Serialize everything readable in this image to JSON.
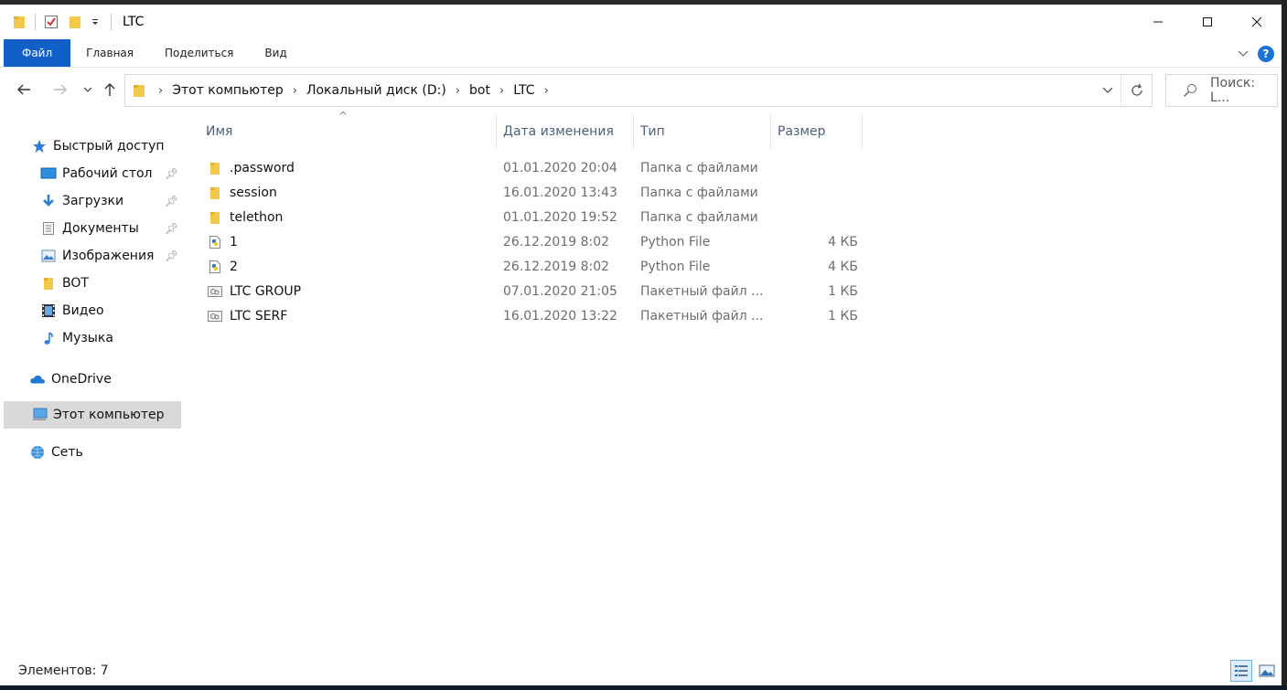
{
  "window": {
    "title": "LTC",
    "controls": {
      "minimize": "—",
      "maximize": "☐",
      "close": "✕"
    }
  },
  "ribbon": {
    "tabs": [
      "Файл",
      "Главная",
      "Поделиться",
      "Вид"
    ],
    "help": "?"
  },
  "nav": {
    "breadcrumb": [
      "Этот компьютер",
      "Локальный диск (D:)",
      "bot",
      "LTC"
    ],
    "search_placeholder": "Поиск: L..."
  },
  "sidebar": {
    "items": [
      {
        "label": "Быстрый доступ",
        "icon": "star-icon"
      },
      {
        "label": "Рабочий стол",
        "icon": "desktop-icon",
        "pinned": true
      },
      {
        "label": "Загрузки",
        "icon": "download-icon",
        "pinned": true
      },
      {
        "label": "Документы",
        "icon": "documents-icon",
        "pinned": true
      },
      {
        "label": "Изображения",
        "icon": "pictures-icon",
        "pinned": true
      },
      {
        "label": "BOT",
        "icon": "folder-icon"
      },
      {
        "label": "Видео",
        "icon": "video-icon"
      },
      {
        "label": "Музыка",
        "icon": "music-icon"
      },
      {
        "label": "OneDrive",
        "icon": "cloud-icon"
      },
      {
        "label": "Этот компьютер",
        "icon": "computer-icon",
        "selected": true
      },
      {
        "label": "Сеть",
        "icon": "network-icon"
      }
    ]
  },
  "columns": {
    "name": "Имя",
    "date": "Дата изменения",
    "type": "Тип",
    "size": "Размер"
  },
  "files": [
    {
      "name": ".password",
      "date": "01.01.2020 20:04",
      "type": "Папка с файлами",
      "size": "",
      "icon": "folder-icon"
    },
    {
      "name": "session",
      "date": "16.01.2020 13:43",
      "type": "Папка с файлами",
      "size": "",
      "icon": "folder-icon"
    },
    {
      "name": "telethon",
      "date": "01.01.2020 19:52",
      "type": "Папка с файлами",
      "size": "",
      "icon": "folder-icon"
    },
    {
      "name": "1",
      "date": "26.12.2019 8:02",
      "type": "Python File",
      "size": "4 КБ",
      "icon": "python-file-icon"
    },
    {
      "name": "2",
      "date": "26.12.2019 8:02",
      "type": "Python File",
      "size": "4 КБ",
      "icon": "python-file-icon"
    },
    {
      "name": "LTC GROUP",
      "date": "07.01.2020 21:05",
      "type": "Пакетный файл ...",
      "size": "1 КБ",
      "icon": "batch-file-icon"
    },
    {
      "name": "LTC SERF",
      "date": "16.01.2020 13:22",
      "type": "Пакетный файл ...",
      "size": "1 КБ",
      "icon": "batch-file-icon"
    }
  ],
  "status": {
    "items_count": "Элементов: 7"
  },
  "colors": {
    "accent": "#1160c8",
    "folder": "#f3c94c",
    "selected": "#d9d9d9"
  }
}
